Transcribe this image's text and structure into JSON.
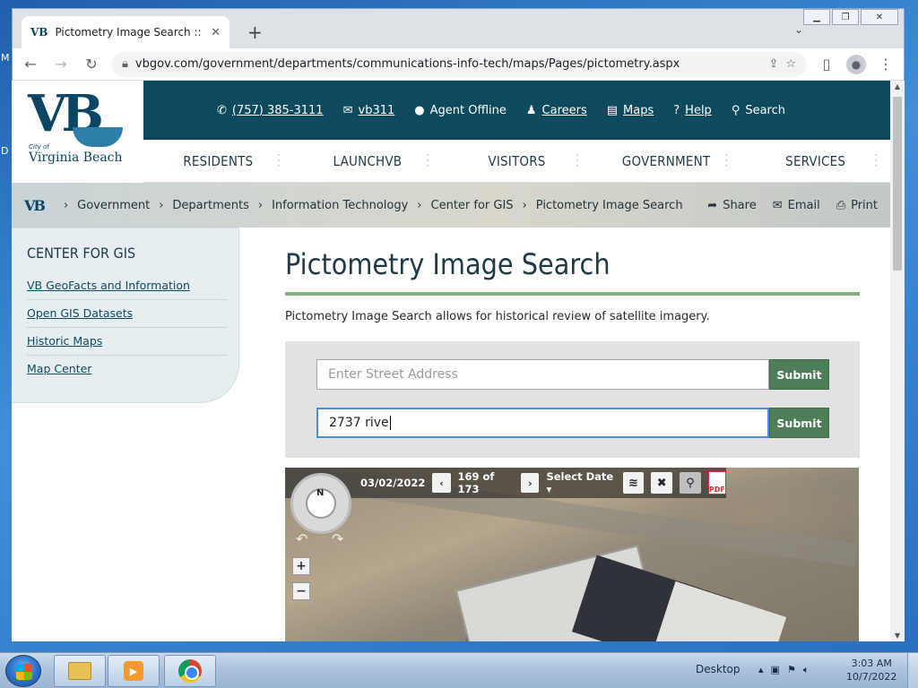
{
  "browser": {
    "tab_title": "Pictometry Image Search :: VBgov",
    "tab_favicon": "VB",
    "url": "vbgov.com/government/departments/communications-info-tech/maps/Pages/pictometry.aspx"
  },
  "desktop": {
    "frag_top": "M",
    "frag_mid": "D"
  },
  "site": {
    "logo": {
      "mark": "VB",
      "city": "City of",
      "name": "Virginia Beach"
    },
    "utility": [
      {
        "icon": "phone-icon",
        "glyph": "✆",
        "label": "(757) 385-3111",
        "link": true
      },
      {
        "icon": "envelope-icon",
        "glyph": "✉",
        "label": "vb311",
        "link": true
      },
      {
        "icon": "chat-icon",
        "glyph": "●",
        "label": "Agent Offline",
        "link": false
      },
      {
        "icon": "user-plus-icon",
        "glyph": "♟",
        "label": "Careers",
        "link": true
      },
      {
        "icon": "map-icon",
        "glyph": "▤",
        "label": "Maps",
        "link": true
      },
      {
        "icon": "help-icon",
        "glyph": "?",
        "label": "Help",
        "link": true
      },
      {
        "icon": "search-icon",
        "glyph": "⚲",
        "label": "Search",
        "link": false
      }
    ],
    "nav": [
      "RESIDENTS",
      "LAUNCHVB",
      "VISITORS",
      "GOVERNMENT",
      "SERVICES"
    ],
    "breadcrumb": {
      "logo": "VB",
      "items": [
        "Government",
        "Departments",
        "Information Technology",
        "Center for GIS",
        "Pictometry Image Search"
      ],
      "actions": [
        "Share",
        "Email",
        "Print"
      ]
    },
    "sidebar": {
      "title": "CENTER FOR GIS",
      "links": [
        "VB GeoFacts and Information",
        "Open GIS Datasets",
        "Historic Maps",
        "Map Center"
      ]
    },
    "main": {
      "title": "Pictometry Image Search",
      "intro": "Pictometry Image Search allows for historical review of satellite imagery.",
      "search1": {
        "placeholder": "Enter Street Address",
        "button": "Submit"
      },
      "search2": {
        "value": "2737 rive",
        "button": "Submit"
      },
      "map": {
        "date": "03/02/2022",
        "counter": "169 of 173",
        "select_date": "Select Date",
        "compass": "N",
        "zoom_in": "+",
        "zoom_out": "−",
        "pdf_label": "PDF"
      }
    }
  },
  "taskbar": {
    "desktop_label": "Desktop",
    "time": "3:03 AM",
    "date": "10/7/2022"
  }
}
